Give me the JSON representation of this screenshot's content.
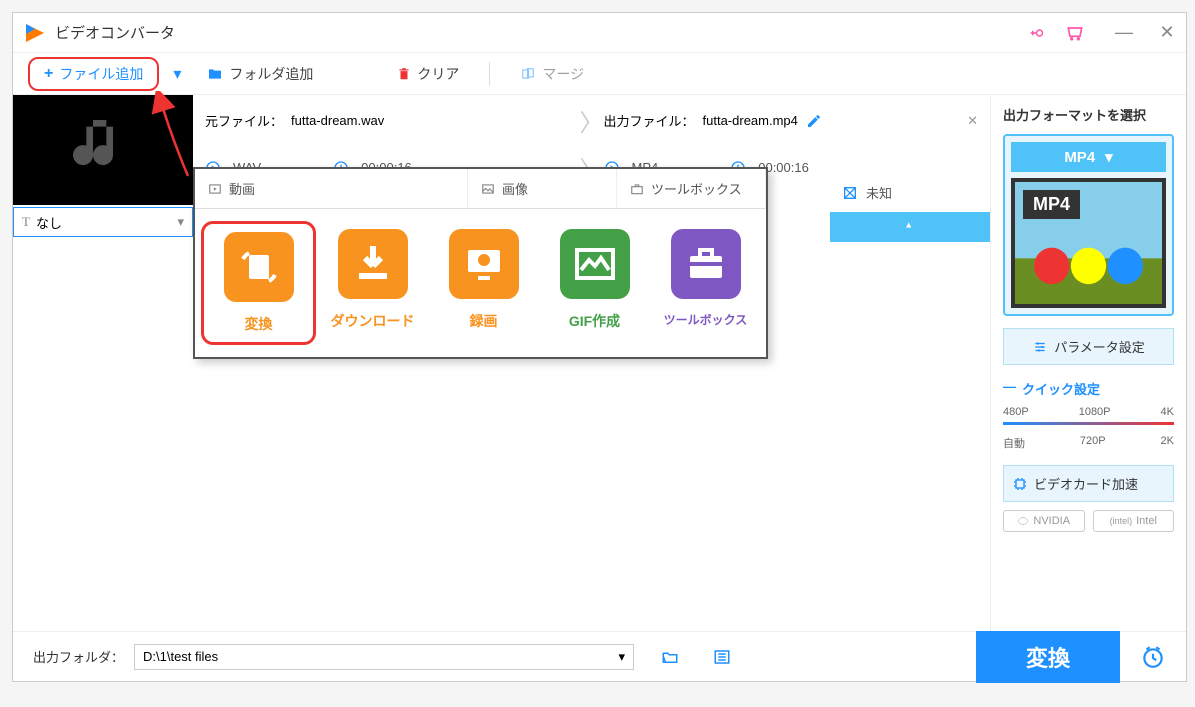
{
  "app": {
    "title": "ビデオコンバータ"
  },
  "toolbar": {
    "add_file": "ファイル追加",
    "add_folder": "フォルダ追加",
    "clear": "クリア",
    "merge": "マージ"
  },
  "subtitle": {
    "label": "なし"
  },
  "source": {
    "label": "元ファイル：",
    "filename": "futta-dream.wav",
    "format": "WAV",
    "duration": "00:00:16"
  },
  "output": {
    "label": "出力ファイル：",
    "filename": "futta-dream.mp4",
    "format": "MP4",
    "duration": "00:00:16",
    "size": "未知"
  },
  "tools": {
    "tabs": {
      "video": "動画",
      "image": "画像",
      "toolbox": "ツールボックス"
    },
    "items": [
      {
        "label": "変換",
        "color": "#f7931e"
      },
      {
        "label": "ダウンロード",
        "color": "#f7931e"
      },
      {
        "label": "録画",
        "color": "#f7931e"
      },
      {
        "label": "GIF作成",
        "color": "#43a047"
      },
      {
        "label": "ツールボックス",
        "color": "#7b1fa2"
      }
    ]
  },
  "right": {
    "header": "出力フォーマットを選択",
    "format": "MP4",
    "param_btn": "パラメータ設定",
    "quick_header": "クイック設定",
    "resolutions_top": [
      "480P",
      "1080P",
      "4K"
    ],
    "resolutions_bottom": [
      "自動",
      "720P",
      "2K"
    ],
    "gpu_btn": "ビデオカード加速",
    "gpu_chips": [
      "NVIDIA",
      "Intel"
    ]
  },
  "bottom": {
    "out_label": "出力フォルダ：",
    "out_path": "D:\\1\\test files",
    "convert_btn": "変換"
  }
}
